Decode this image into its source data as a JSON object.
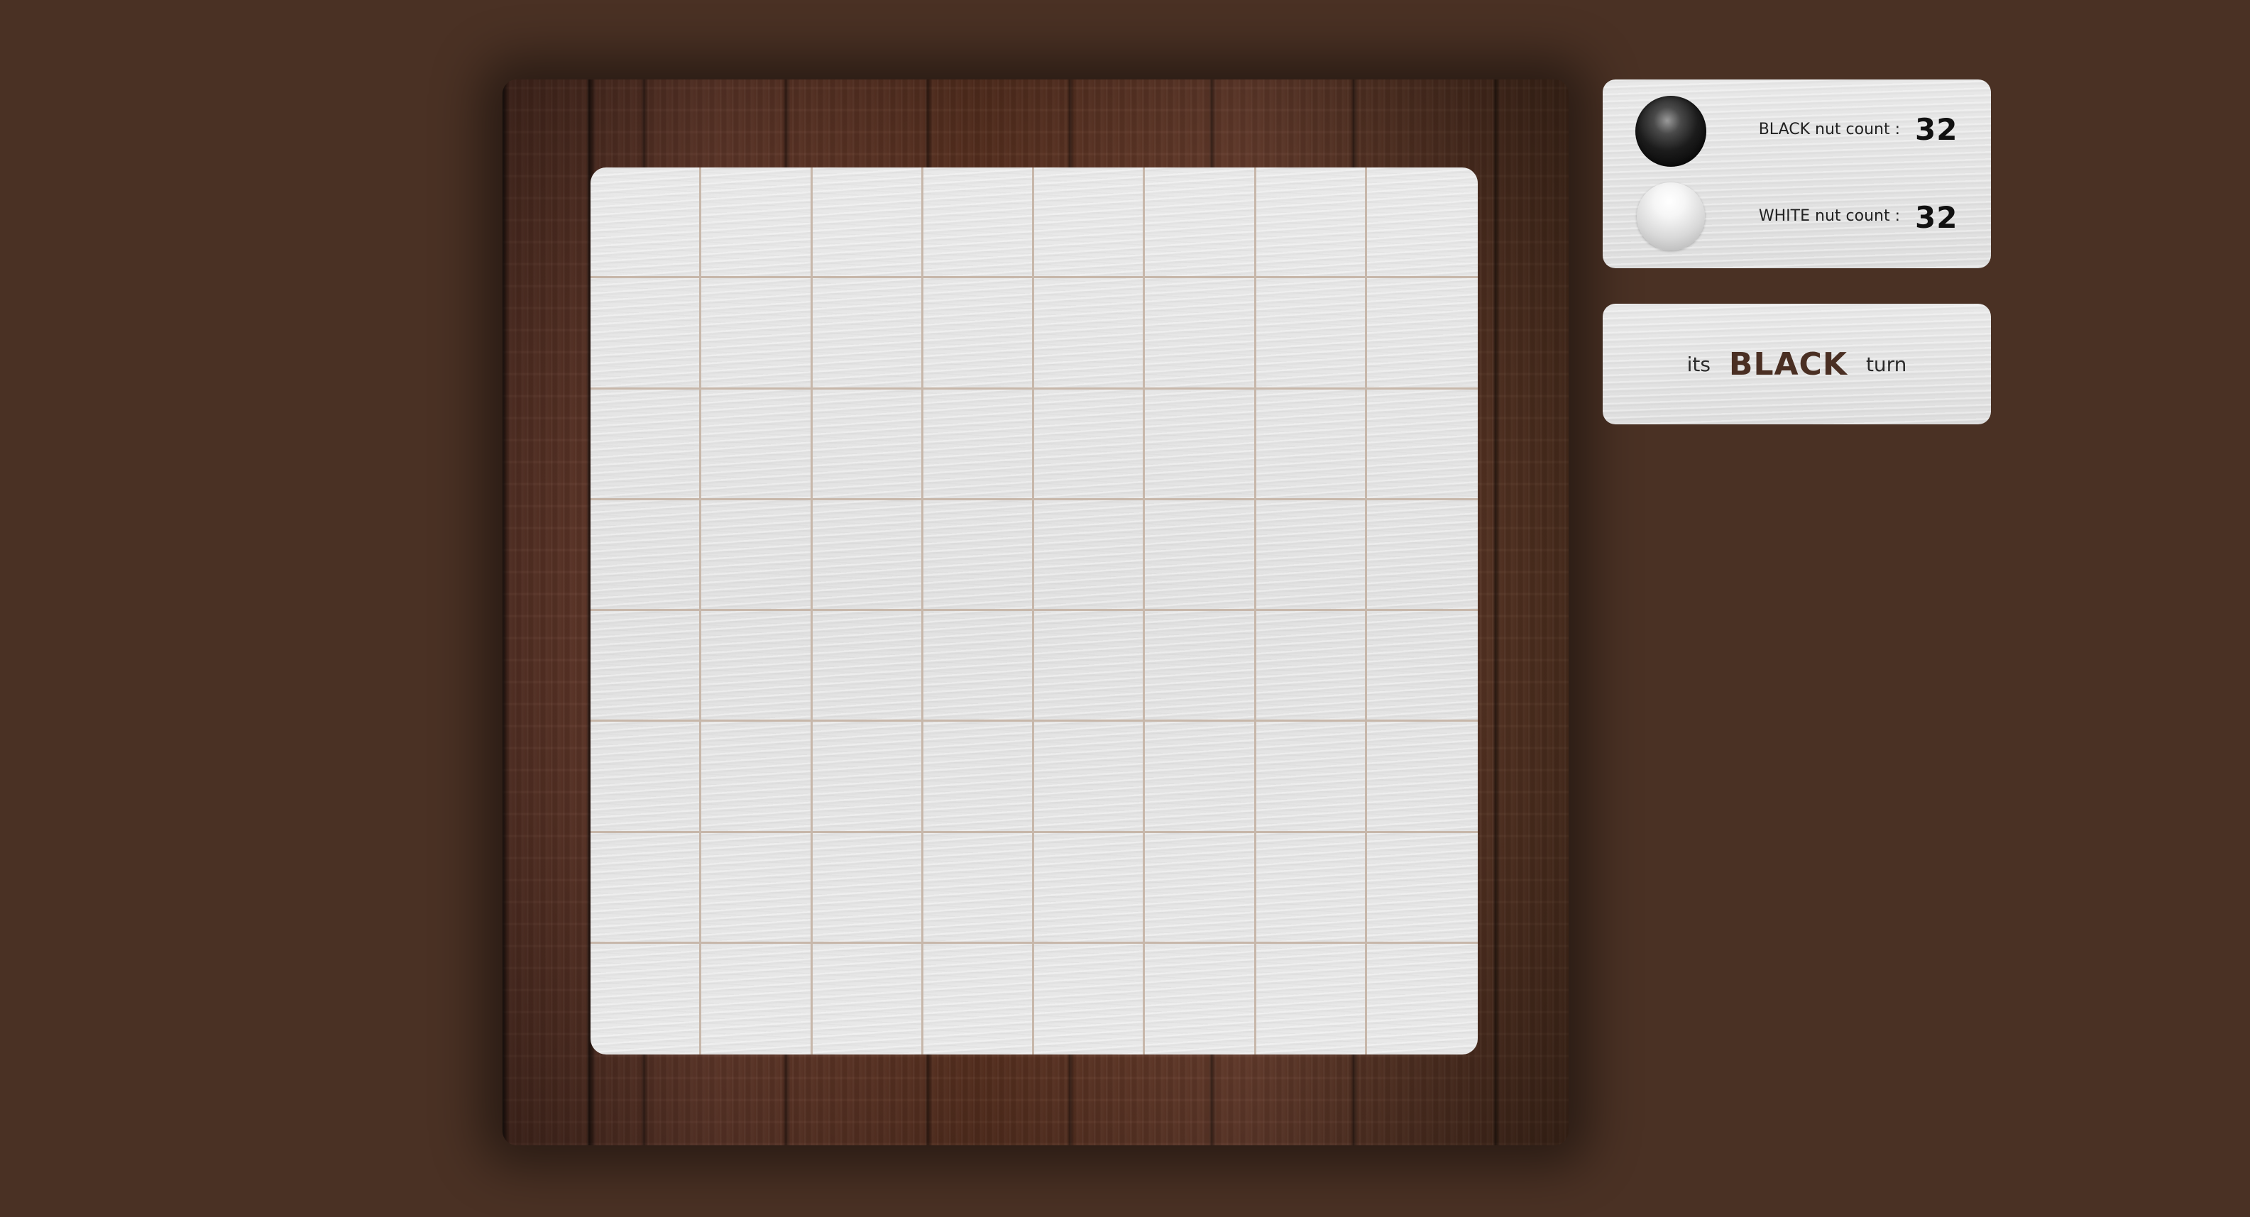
{
  "board": {
    "rows": 8,
    "cols": 8
  },
  "score": {
    "black": {
      "stone_icon": "black-stone-icon",
      "label": "BLACK nut count :",
      "value": "32"
    },
    "white": {
      "stone_icon": "white-stone-icon",
      "label": "WHITE nut count :",
      "value": "32"
    }
  },
  "turn": {
    "prefix": "its",
    "player": "BLACK",
    "suffix": "turn"
  },
  "colors": {
    "background": "#4a3124",
    "wood": "#5a3326",
    "play_area": "#e6e6e6",
    "grid_line": "#c7b7aa",
    "turn_player_text": "#4a2f23"
  }
}
